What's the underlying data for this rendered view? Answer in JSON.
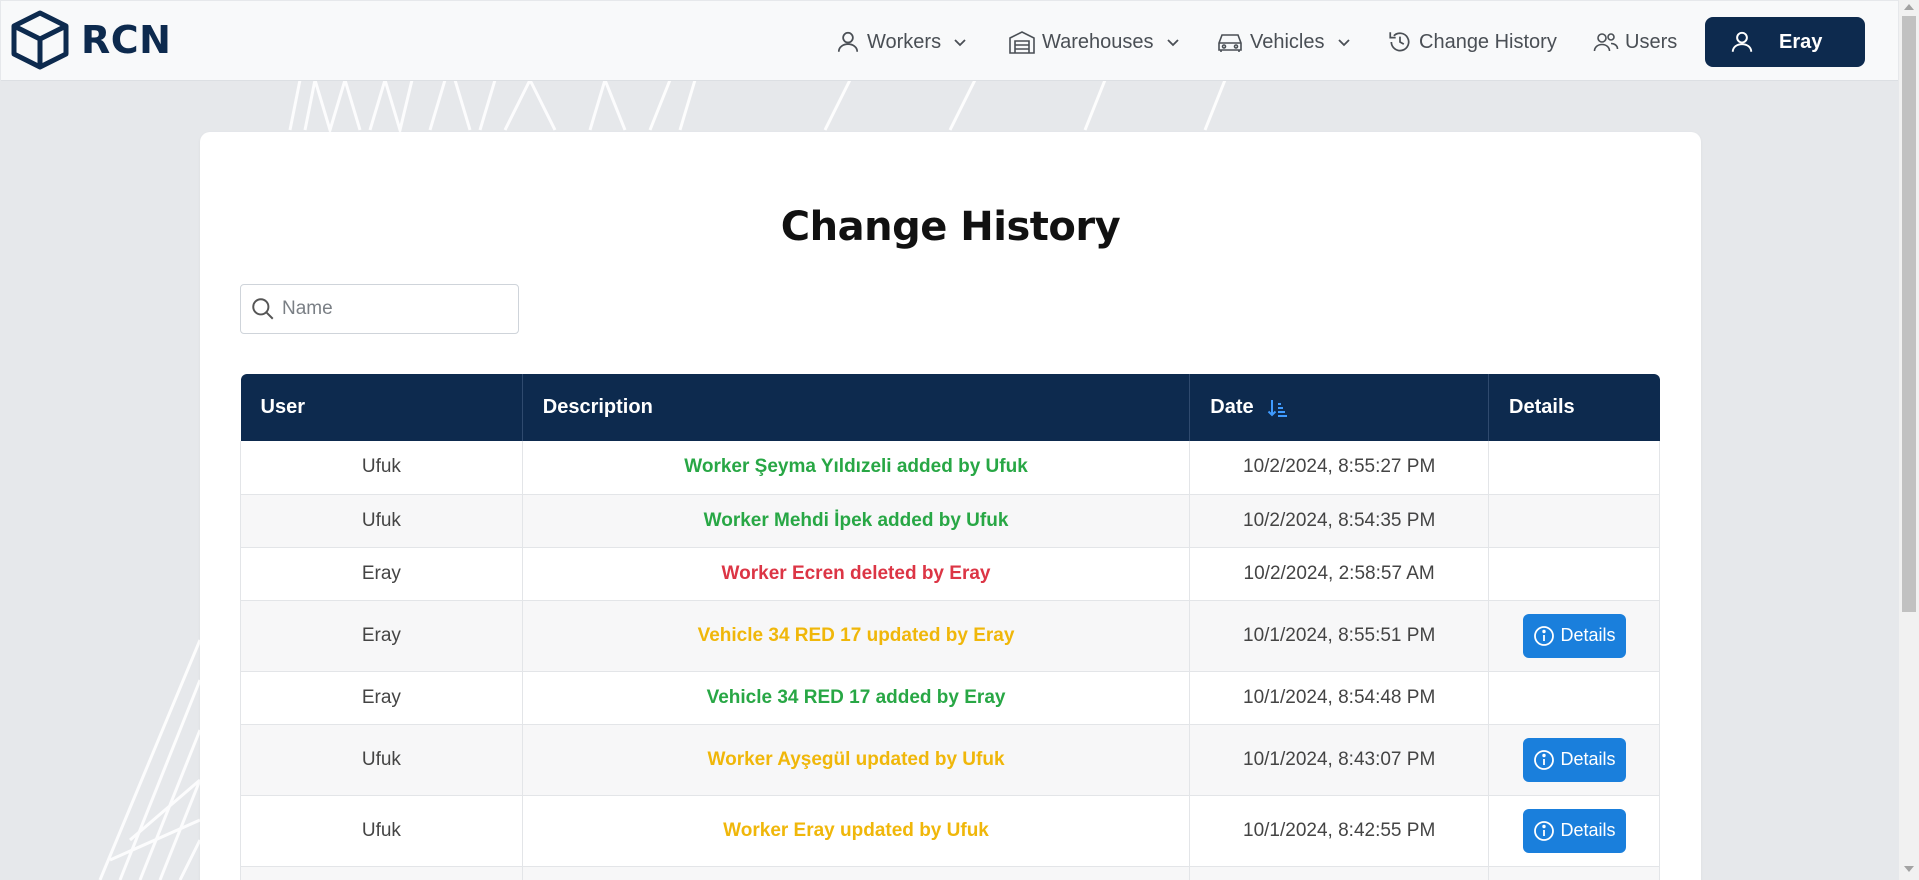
{
  "brand": {
    "name": "RCN",
    "logo_icon": "cube-icon"
  },
  "nav": {
    "workers": "Workers",
    "warehouses": "Warehouses",
    "vehicles": "Vehicles",
    "change_history": "Change History",
    "users": "Users",
    "current_user": "Eray"
  },
  "page": {
    "title": "Change History"
  },
  "search": {
    "placeholder": "Name"
  },
  "table": {
    "headers": {
      "user": "User",
      "description": "Description",
      "date": "Date",
      "details": "Details"
    },
    "rows": [
      {
        "user": "Ufuk",
        "description": "Worker Şeyma Yıldızeli added by Ufuk",
        "status": "added",
        "date": "10/2/2024, 8:55:27 PM",
        "details": ""
      },
      {
        "user": "Ufuk",
        "description": "Worker Mehdi İpek added by Ufuk",
        "status": "added",
        "date": "10/2/2024, 8:54:35 PM",
        "details": ""
      },
      {
        "user": "Eray",
        "description": "Worker Ecren deleted by Eray",
        "status": "deleted",
        "date": "10/2/2024, 2:58:57 AM",
        "details": ""
      },
      {
        "user": "Eray",
        "description": "Vehicle 34 RED 17 updated by Eray",
        "status": "updated",
        "date": "10/1/2024, 8:55:51 PM",
        "details": "Details"
      },
      {
        "user": "Eray",
        "description": "Vehicle 34 RED 17 added by Eray",
        "status": "added",
        "date": "10/1/2024, 8:54:48 PM",
        "details": ""
      },
      {
        "user": "Ufuk",
        "description": "Worker Ayşegül updated by Ufuk",
        "status": "updated",
        "date": "10/1/2024, 8:43:07 PM",
        "details": "Details"
      },
      {
        "user": "Ufuk",
        "description": "Worker Eray updated by Ufuk",
        "status": "updated",
        "date": "10/1/2024, 8:42:55 PM",
        "details": "Details"
      }
    ]
  },
  "colors": {
    "navy": "#0d2a4e",
    "added": "#28a745",
    "deleted": "#dc3545",
    "updated": "#f0b70a",
    "details_button": "#1a7fdc"
  }
}
